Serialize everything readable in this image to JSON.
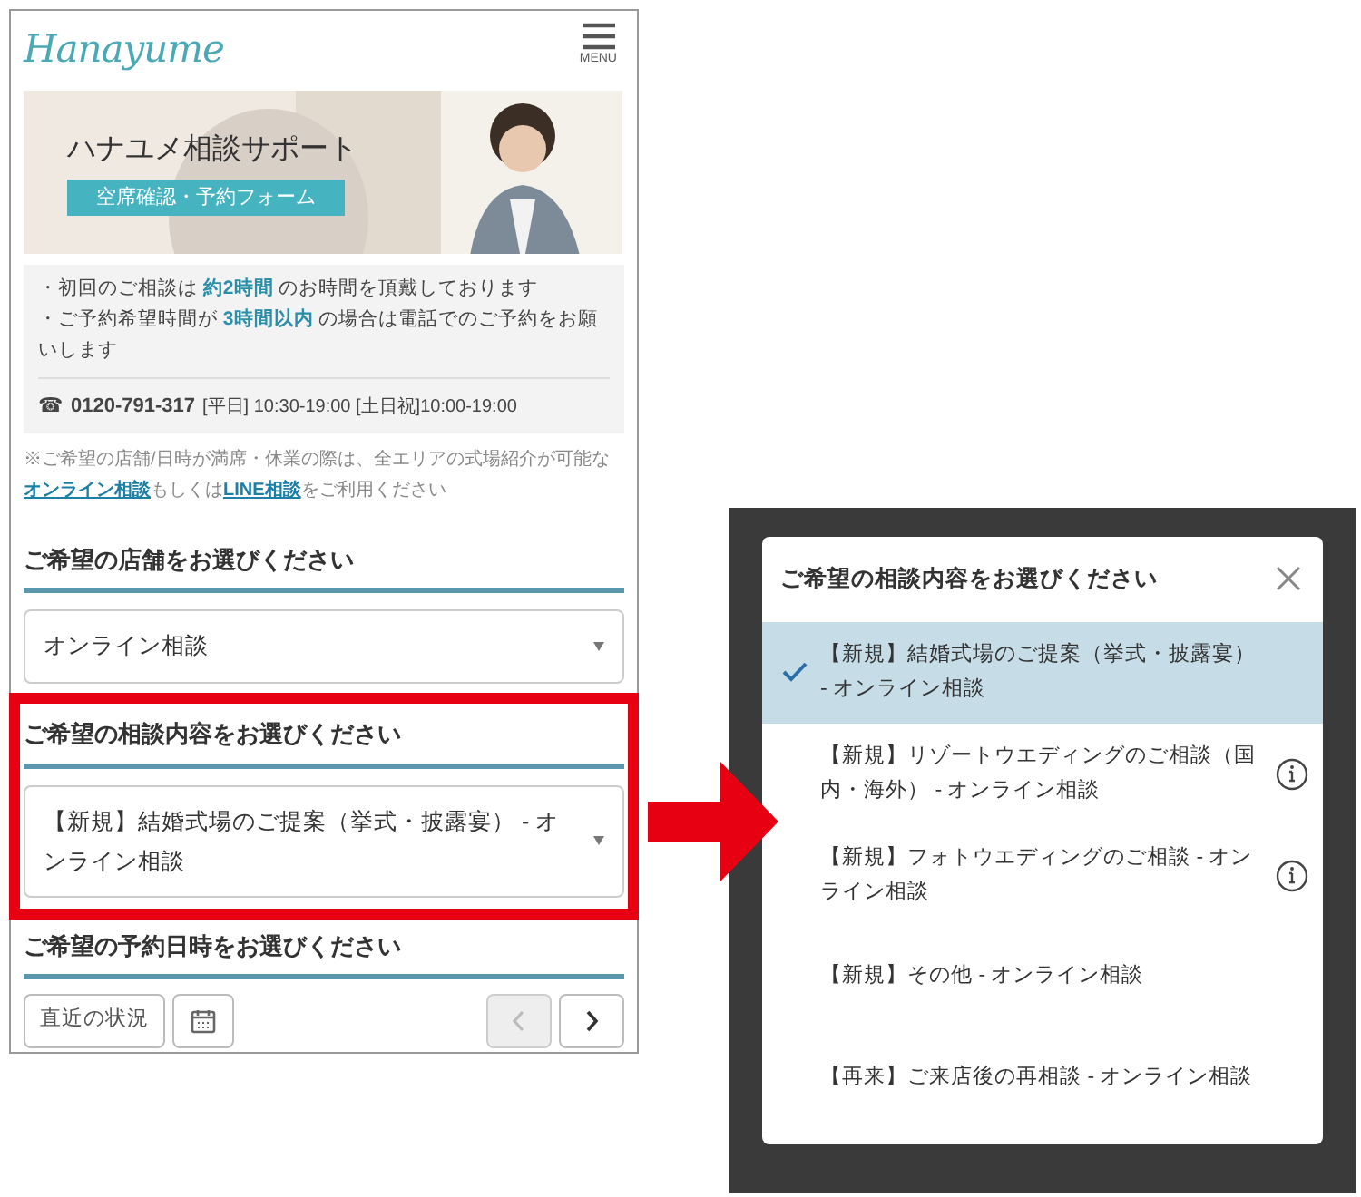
{
  "header": {
    "logo": "Hanayume",
    "menu_label": "MENU"
  },
  "banner": {
    "title": "ハナユメ相談サポート",
    "badge": "空席確認・予約フォーム"
  },
  "notices": [
    "・初回のご相談は **約2時間** のお時間を頂戴しております",
    "・ご予約希望時間が **3時間以内** の場合は電話でのご予約をお願いします"
  ],
  "phone": {
    "icon": "☎",
    "number": "0120-791-317",
    "hours": "[平日] 10:30-19:00 [土日祝]10:00-19:00"
  },
  "note": {
    "before": "※ご希望の店舗/日時が満席・休業の際は、全エリアの式場紹介が可能な",
    "link_1": "オンライン相談",
    "middle": "もしくは",
    "link_2": "LINE相談",
    "after": "をご利用ください"
  },
  "sections": [
    {
      "kind": "select",
      "title": "ご希望の店舗をお選びください",
      "value": "オンライン相談",
      "highlighted": false
    },
    {
      "kind": "select",
      "title": "ご希望の相談内容をお選びください",
      "value": "【新規】結婚式場のご提案（挙式・披露宴） - オンライン相談",
      "highlighted": true
    },
    {
      "kind": "date",
      "title": "ご希望の予約日時をお選びください",
      "button": "直近の状況",
      "prev_disabled": true,
      "next_disabled": false,
      "highlighted": false
    }
  ],
  "modal": {
    "title": "ご希望の相談内容をお選びください",
    "options": [
      {
        "label": "【新規】結婚式場のご提案（挙式・披露宴） - オンライン相談",
        "selected": true,
        "info": false
      },
      {
        "label": "【新規】リゾートウエディングのご相談（国内・海外） - オンライン相談",
        "selected": false,
        "info": true
      },
      {
        "label": "【新規】フォトウエディングのご相談 - オンライン相談",
        "selected": false,
        "info": true
      },
      {
        "label": "【新規】その他 - オンライン相談",
        "selected": false,
        "info": false
      },
      {
        "label": "【再来】ご来店後の再相談 - オンライン相談",
        "selected": false,
        "info": false
      }
    ]
  }
}
